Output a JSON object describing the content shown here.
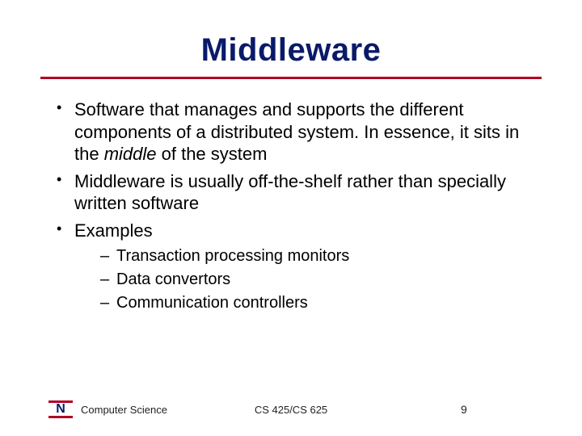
{
  "title": "Middleware",
  "bullets": [
    {
      "pre": "Software that manages and supports the different components of a distributed system. In essence, it sits in the ",
      "em": "middle",
      "post": " of the system"
    },
    {
      "text": "Middleware is usually off-the-shelf rather than specially written software"
    },
    {
      "text": "Examples"
    }
  ],
  "sub_bullets": [
    "Transaction processing monitors",
    "Data convertors",
    "Communication controllers"
  ],
  "footer": {
    "logo_letter": "N",
    "department": "Computer Science",
    "course": "CS 425/CS 625",
    "page": "9"
  }
}
